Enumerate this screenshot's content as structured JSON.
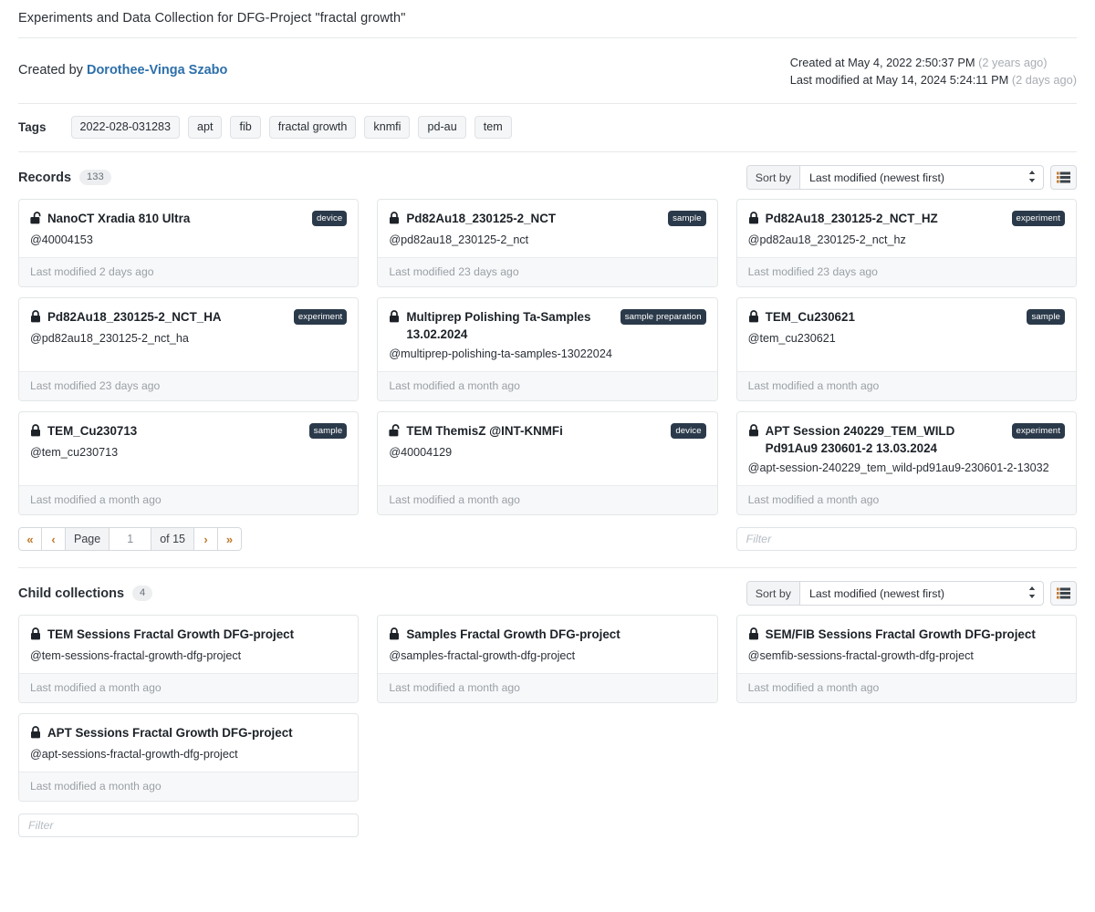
{
  "header": {
    "title": "Experiments and Data Collection for DFG-Project \"fractal growth\"",
    "created_by_prefix": "Created by",
    "author": "Dorothee-Vinga Szabo",
    "created_at": "Created at May 4, 2022 2:50:37 PM",
    "created_at_relative": "(2 years ago)",
    "last_modified_at": "Last modified at May 14, 2024 5:24:11 PM",
    "last_modified_relative": "(2 days ago)"
  },
  "tags": {
    "label": "Tags",
    "items": [
      "2022-028-031283",
      "apt",
      "fib",
      "fractal growth",
      "knmfi",
      "pd-au",
      "tem"
    ]
  },
  "records": {
    "label": "Records",
    "count": "133",
    "sort_label": "Sort by",
    "sort_value": "Last modified (newest first)",
    "list_view_icon": "list-icon",
    "items": [
      {
        "locked": false,
        "lock_icon": "unlock-icon",
        "title": "NanoCT Xradia 810 Ultra",
        "identifier": "@40004153",
        "badge": "device",
        "modified": "Last modified 2 days ago"
      },
      {
        "locked": true,
        "lock_icon": "lock-icon",
        "title": "Pd82Au18_230125-2_NCT",
        "identifier": "@pd82au18_230125-2_nct",
        "badge": "sample",
        "modified": "Last modified 23 days ago"
      },
      {
        "locked": true,
        "lock_icon": "lock-icon",
        "title": "Pd82Au18_230125-2_NCT_HZ",
        "identifier": "@pd82au18_230125-2_nct_hz",
        "badge": "experiment",
        "modified": "Last modified 23 days ago"
      },
      {
        "locked": true,
        "lock_icon": "lock-icon",
        "title": "Pd82Au18_230125-2_NCT_HA",
        "identifier": "@pd82au18_230125-2_nct_ha",
        "badge": "experiment",
        "modified": "Last modified 23 days ago"
      },
      {
        "locked": true,
        "lock_icon": "lock-icon",
        "title": "Multiprep Polishing Ta-Samples 13.02.2024",
        "identifier": "@multiprep-polishing-ta-samples-13022024",
        "badge": "sample preparation",
        "modified": "Last modified a month ago"
      },
      {
        "locked": true,
        "lock_icon": "lock-icon",
        "title": "TEM_Cu230621",
        "identifier": "@tem_cu230621",
        "badge": "sample",
        "modified": "Last modified a month ago"
      },
      {
        "locked": true,
        "lock_icon": "lock-icon",
        "title": "TEM_Cu230713",
        "identifier": "@tem_cu230713",
        "badge": "sample",
        "modified": "Last modified a month ago"
      },
      {
        "locked": false,
        "lock_icon": "unlock-icon",
        "title": "TEM ThemisZ @INT-KNMFi",
        "identifier": "@40004129",
        "badge": "device",
        "modified": "Last modified a month ago"
      },
      {
        "locked": true,
        "lock_icon": "lock-icon",
        "title": "APT Session 240229_TEM_WILD Pd91Au9 230601-2 13.03.2024",
        "identifier": "@apt-session-240229_tem_wild-pd91au9-230601-2-13032",
        "badge": "experiment",
        "modified": "Last modified a month ago"
      }
    ],
    "pagination": {
      "first": "«",
      "prev": "‹",
      "page_label": "Page",
      "page_value": "1",
      "of_label": "of 15",
      "next": "›",
      "last": "»"
    },
    "filter_placeholder": "Filter"
  },
  "child_collections": {
    "label": "Child collections",
    "count": "4",
    "sort_label": "Sort by",
    "sort_value": "Last modified (newest first)",
    "list_view_icon": "list-icon",
    "items": [
      {
        "locked": true,
        "lock_icon": "lock-icon",
        "title": "TEM Sessions Fractal Growth DFG-project",
        "identifier": "@tem-sessions-fractal-growth-dfg-project",
        "modified": "Last modified a month ago"
      },
      {
        "locked": true,
        "lock_icon": "lock-icon",
        "title": "Samples Fractal Growth DFG-project",
        "identifier": "@samples-fractal-growth-dfg-project",
        "modified": "Last modified a month ago"
      },
      {
        "locked": true,
        "lock_icon": "lock-icon",
        "title": "SEM/FIB Sessions Fractal Growth DFG-project",
        "identifier": "@semfib-sessions-fractal-growth-dfg-project",
        "modified": "Last modified a month ago"
      },
      {
        "locked": true,
        "lock_icon": "lock-icon",
        "title": "APT Sessions Fractal Growth DFG-project",
        "identifier": "@apt-sessions-fractal-growth-dfg-project",
        "modified": "Last modified a month ago"
      }
    ],
    "filter_placeholder": "Filter"
  },
  "colors": {
    "badge_bg": "#2b3a4a",
    "link": "#2c6faa",
    "muted": "#9aa0a6",
    "pager_arrow": "#c07a2a"
  }
}
